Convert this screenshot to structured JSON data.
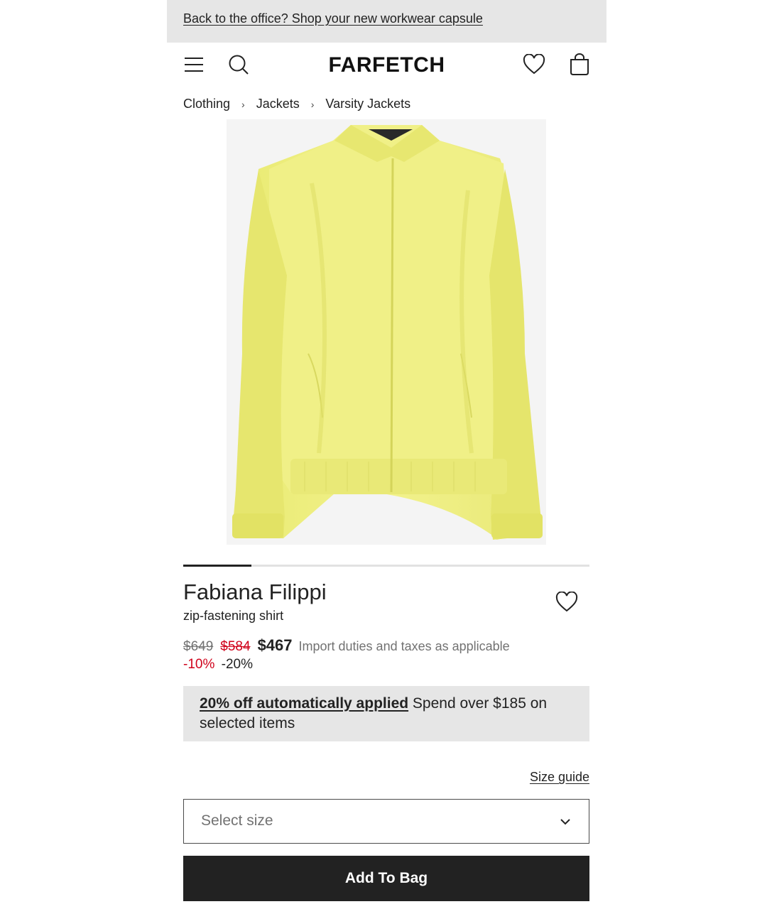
{
  "promo": {
    "text": "Back to the office? Shop your new workwear capsule"
  },
  "header": {
    "logo": "FARFETCH",
    "icons": [
      "menu-icon",
      "search-icon",
      "heart-icon",
      "bag-icon"
    ]
  },
  "breadcrumb": {
    "items": [
      "Clothing",
      "Jackets",
      "Varsity Jackets"
    ],
    "separator": "›"
  },
  "gallery": {
    "progress": 0.167
  },
  "product": {
    "brand": "Fabiana Filippi",
    "description": "zip-fastening shirt",
    "price_original": "$649",
    "price_intermediate": "$584",
    "price_final": "$467",
    "price_note": "Import duties and taxes as applicable",
    "discount_1": "-10%",
    "discount_2": "-20%"
  },
  "offer": {
    "bold_text": "20% off automatically applied",
    "text": " Spend over $185 on selected items"
  },
  "size": {
    "guide_label": "Size guide",
    "select_placeholder": "Select size"
  },
  "actions": {
    "add_to_bag": "Add To Bag"
  },
  "colors": {
    "accent_red": "#d0021b",
    "button_dark": "#222222",
    "banner_grey": "#e6e6e6",
    "garment_yellow": "#efef7e"
  }
}
